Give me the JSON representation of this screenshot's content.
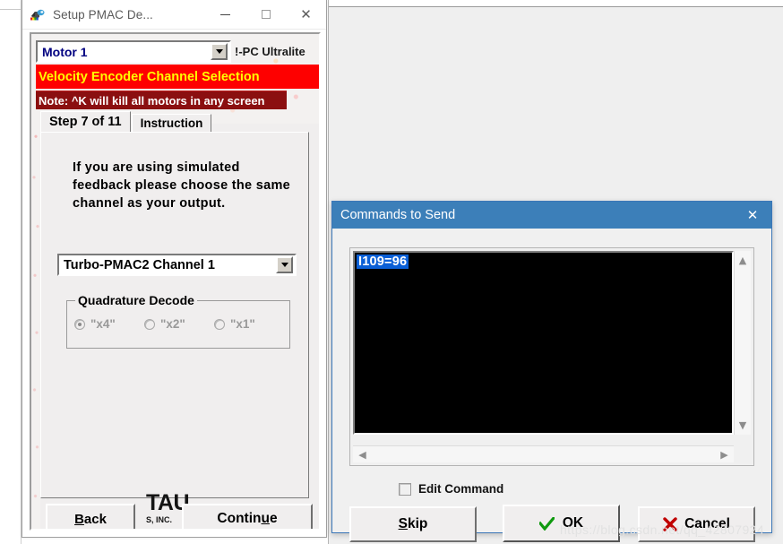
{
  "wizard_window": {
    "title": "Setup PMAC De...",
    "app_icon": "pmac-app-icon",
    "caption": {
      "minimize": "minimize-icon",
      "maximize": "maximize-icon",
      "close": "✕"
    },
    "motor_select": {
      "value": "Motor 1",
      "arrow": "chevron-down-icon"
    },
    "device_label": "!-PC Ultralite",
    "banner": "Velocity Encoder Channel Selection",
    "note": "Note: ^K will kill all motors in any screen",
    "tabs": [
      {
        "label": "Step 7 of 11",
        "active": true
      },
      {
        "label": "Instruction",
        "active": false
      }
    ],
    "instruction_text": "If you are using simulated feedback please choose the same channel as your output.",
    "channel_select": {
      "value": "Turbo-PMAC2 Channel 1",
      "arrow": "chevron-down-icon"
    },
    "quadrature_group": {
      "legend": "Quadrature Decode",
      "options": [
        {
          "label": "\"x4\"",
          "checked": true
        },
        {
          "label": "\"x2\"",
          "checked": false
        },
        {
          "label": "\"x1\"",
          "checked": false
        }
      ]
    },
    "logo": {
      "main": "TAU",
      "sub": "S, INC."
    },
    "buttons": {
      "back": "Back",
      "continue": "Continue"
    },
    "chevron_mark": "∨"
  },
  "commands_dialog": {
    "title": "Commands to Send",
    "close": "✕",
    "commands": [
      "I109=96"
    ],
    "scroll": {
      "up": "▲",
      "down": "▼",
      "left": "◄",
      "right": "►"
    },
    "edit_command": {
      "label": "Edit Command",
      "checked": false
    },
    "buttons": {
      "skip": "Skip",
      "ok": "OK",
      "cancel": "Cancel"
    },
    "colors": {
      "titlebar": "#3c7fb9",
      "selection": "#0a5fd6",
      "ok_check": "#109c10",
      "cancel_x": "#c00000"
    }
  },
  "watermark": "https://blog.csdn.net/qq_42807924"
}
